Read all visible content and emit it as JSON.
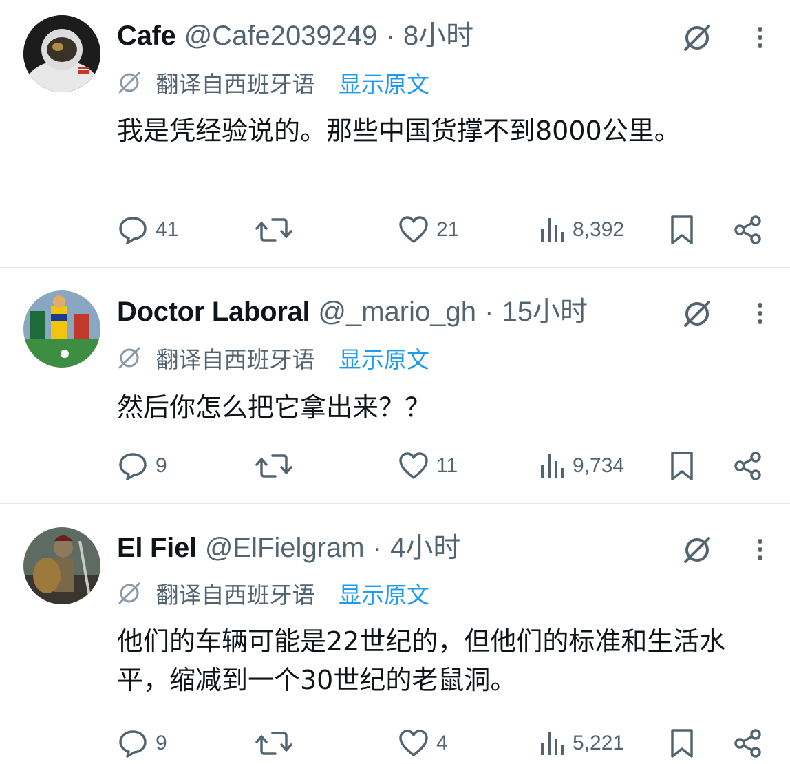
{
  "tweets": [
    {
      "name": "Cafe",
      "handle": "@Cafe2039249",
      "separator": "·",
      "time": "8小时",
      "translated_label": "翻译自西班牙语",
      "show_original": "显示原文",
      "text": "我是凭经验说的。那些中国货撑不到8000公里。",
      "replies": "41",
      "retweets": "",
      "likes": "21",
      "views": "8,392"
    },
    {
      "name": "Doctor Laboral",
      "handle": "@_mario_gh",
      "separator": "·",
      "time": "15小时",
      "translated_label": "翻译自西班牙语",
      "show_original": "显示原文",
      "text": "然后你怎么把它拿出来？？",
      "replies": "9",
      "retweets": "",
      "likes": "11",
      "views": "9,734"
    },
    {
      "name": "El Fiel",
      "handle": "@ElFielgram",
      "separator": "·",
      "time": "4小时",
      "translated_label": "翻译自西班牙语",
      "show_original": "显示原文",
      "text": "他们的车辆可能是22世纪的，但他们的标准和生活水平，缩减到一个30世纪的老鼠洞。",
      "replies": "9",
      "retweets": "",
      "likes": "4",
      "views": "5,221"
    }
  ],
  "colors": {
    "link": "#1d9bf0",
    "muted": "#536471",
    "text": "#0f1419"
  },
  "icons": [
    "grok-slash-icon",
    "more-icon",
    "reply-icon",
    "retweet-icon",
    "like-icon",
    "views-icon",
    "bookmark-icon",
    "share-icon"
  ]
}
